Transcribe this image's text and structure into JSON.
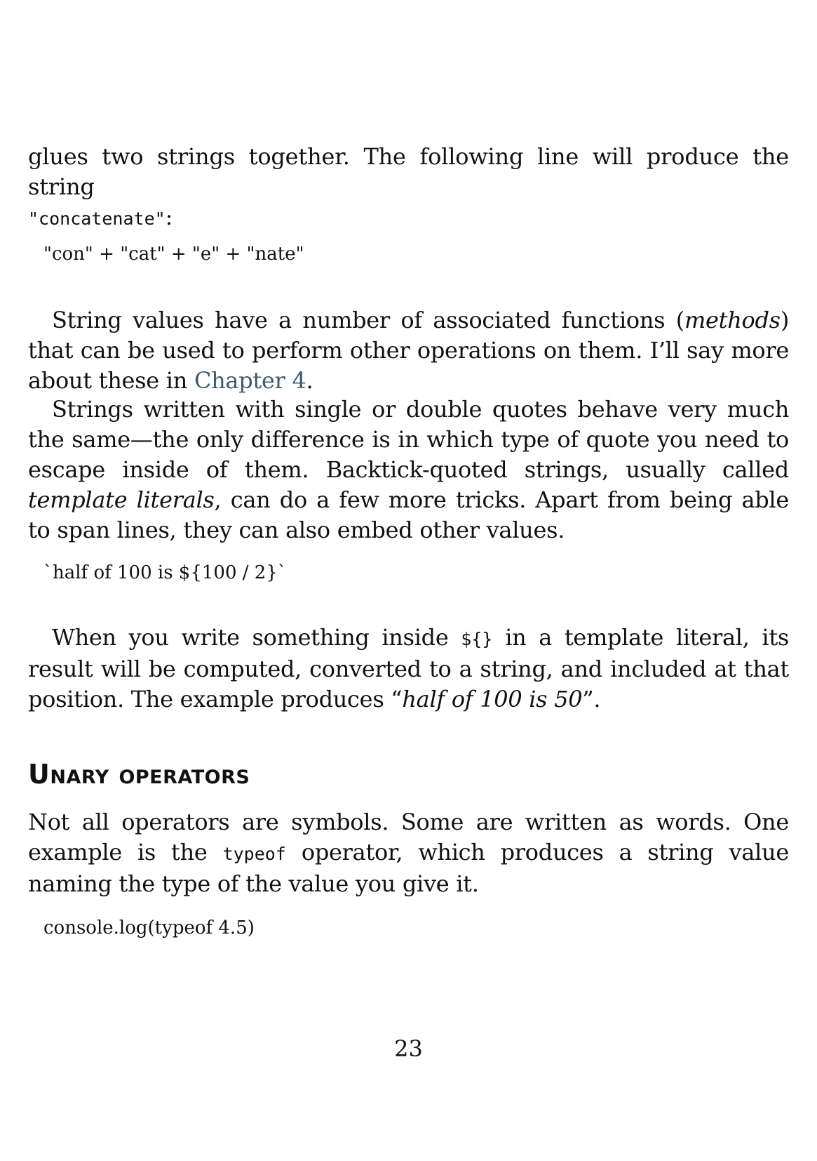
{
  "paragraphs": {
    "p1": {
      "text": "glues two strings together. The following line will produce the string",
      "code": "\"concatenate\"",
      "after": ":"
    },
    "code1": "\"con\" + \"cat\" + \"e\" + \"nate\"",
    "p2": {
      "a": "String values have a number of associated functions (",
      "em": "methods",
      "b": ") that can be used to perform other operations on them. I’ll say more about these in ",
      "link": "Chapter 4",
      "c": "."
    },
    "p3": {
      "a": "Strings written with single or double quotes behave very much the same—the only difference is in which type of quote you need to escape inside of them. Backtick-quoted strings, usually called ",
      "em": "template literals",
      "b": ", can do a few more tricks. Apart from being able to span lines, they can also embed other values."
    },
    "code2": "`half of 100 is ${100 / 2}`",
    "p4": {
      "a": "When you write something inside ",
      "code": "${}",
      "b": " in a template literal, its result will be computed, converted to a string, and included at that position. The example produces “",
      "em": "half of 100 is 50",
      "c": "”."
    }
  },
  "section": {
    "heading": "Unary operators",
    "p5": {
      "a": "Not all operators are symbols. Some are written as words. One example is the ",
      "code": "typeof",
      "b": " operator, which produces a string value naming the type of the value you give it."
    },
    "code3": "console.log(typeof 4.5)"
  },
  "page_number": "23"
}
